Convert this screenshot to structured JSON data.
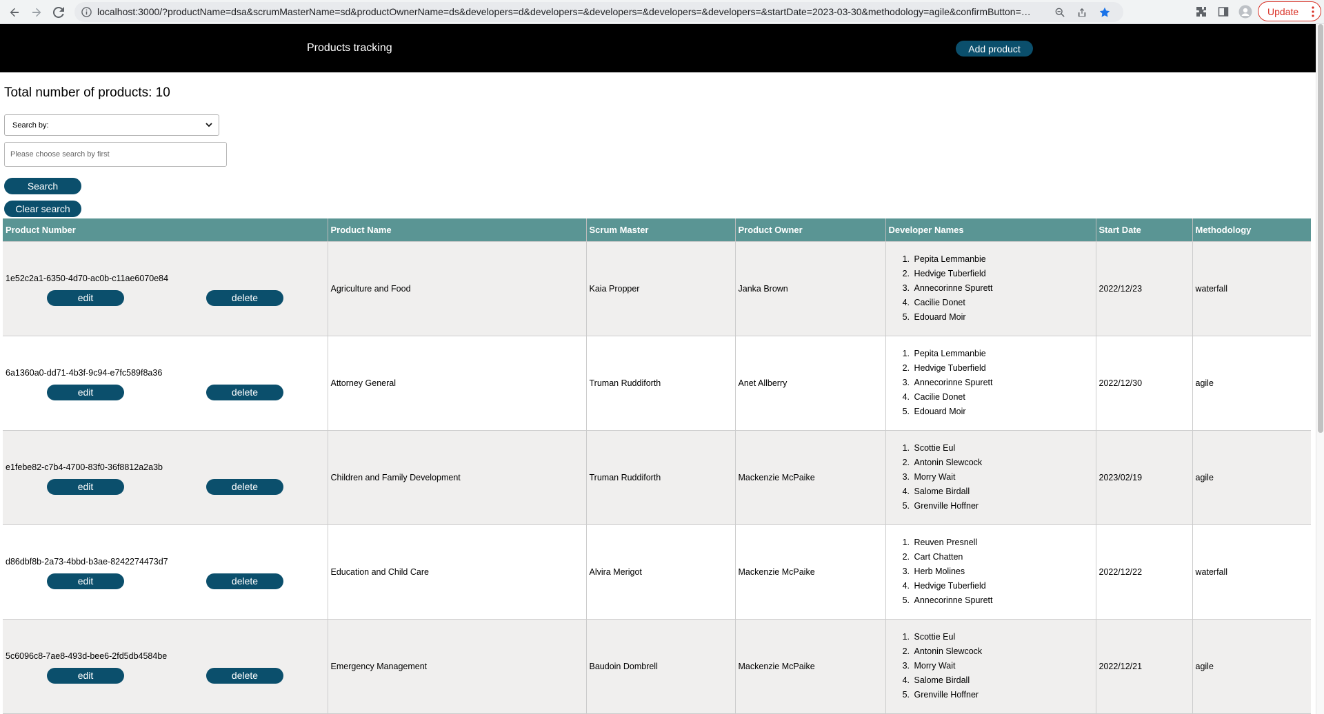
{
  "browser": {
    "url": "localhost:3000/?productName=dsa&scrumMasterName=sd&productOwnerName=ds&developers=d&developers=&developers=&developers=&developers=&startDate=2023-03-30&methodology=agile&confirmButton=Sub...",
    "update_label": "Update"
  },
  "header": {
    "title": "Products tracking",
    "add_label": "Add product"
  },
  "summary": {
    "total": "Total number of products: 10"
  },
  "search": {
    "select_value": "Search by:",
    "input_placeholder": "Please choose search by first",
    "search_label": "Search",
    "clear_label": "Clear search"
  },
  "table": {
    "columns": [
      "Product Number",
      "Product Name",
      "Scrum Master",
      "Product Owner",
      "Developer Names",
      "Start Date",
      "Methodology"
    ],
    "edit_label": "edit",
    "delete_label": "delete",
    "rows": [
      {
        "id": "1e52c2a1-6350-4d70-ac0b-c11ae6070e84",
        "name": "Agriculture and Food",
        "scrum_master": "Kaia Propper",
        "owner": "Janka Brown",
        "developers": [
          "Pepita Lemmanbie",
          "Hedvige Tuberfield",
          "Annecorinne Spurett",
          "Cacilie Donet",
          "Edouard Moir"
        ],
        "start_date": "2022/12/23",
        "methodology": "waterfall"
      },
      {
        "id": "6a1360a0-dd71-4b3f-9c94-e7fc589f8a36",
        "name": "Attorney General",
        "scrum_master": "Truman Ruddiforth",
        "owner": "Anet Allberry",
        "developers": [
          "Pepita Lemmanbie",
          "Hedvige Tuberfield",
          "Annecorinne Spurett",
          "Cacilie Donet",
          "Edouard Moir"
        ],
        "start_date": "2022/12/30",
        "methodology": "agile"
      },
      {
        "id": "e1febe82-c7b4-4700-83f0-36f8812a2a3b",
        "name": "Children and Family Development",
        "scrum_master": "Truman Ruddiforth",
        "owner": "Mackenzie McPaike",
        "developers": [
          "Scottie Eul",
          "Antonin Slewcock",
          "Morry Wait",
          "Salome Birdall",
          "Grenville Hoffner"
        ],
        "start_date": "2023/02/19",
        "methodology": "agile"
      },
      {
        "id": "d86dbf8b-2a73-4bbd-b3ae-8242274473d7",
        "name": "Education and Child Care",
        "scrum_master": "Alvira Merigot",
        "owner": "Mackenzie McPaike",
        "developers": [
          "Reuven Presnell",
          "Cart Chatten",
          "Herb Molines",
          "Hedvige Tuberfield",
          "Annecorinne Spurett"
        ],
        "start_date": "2022/12/22",
        "methodology": "waterfall"
      },
      {
        "id": "5c6096c8-7ae8-493d-bee6-2fd5db4584be",
        "name": "Emergency Management",
        "scrum_master": "Baudoin Dombrell",
        "owner": "Mackenzie McPaike",
        "developers": [
          "Scottie Eul",
          "Antonin Slewcock",
          "Morry Wait",
          "Salome Birdall",
          "Grenville Hoffner"
        ],
        "start_date": "2022/12/21",
        "methodology": "agile"
      }
    ]
  },
  "colors": {
    "header_bg": "#000000",
    "button": "#0b4f6c",
    "table_header": "#5a9594",
    "row_alt": "#f0efee"
  },
  "icons": [
    "back-arrow-icon",
    "forward-arrow-icon",
    "reload-icon",
    "info-icon",
    "zoom-icon",
    "share-icon",
    "star-icon",
    "extensions-icon",
    "side-panel-icon",
    "profile-icon",
    "more-vert-icon",
    "chevron-down-icon"
  ]
}
